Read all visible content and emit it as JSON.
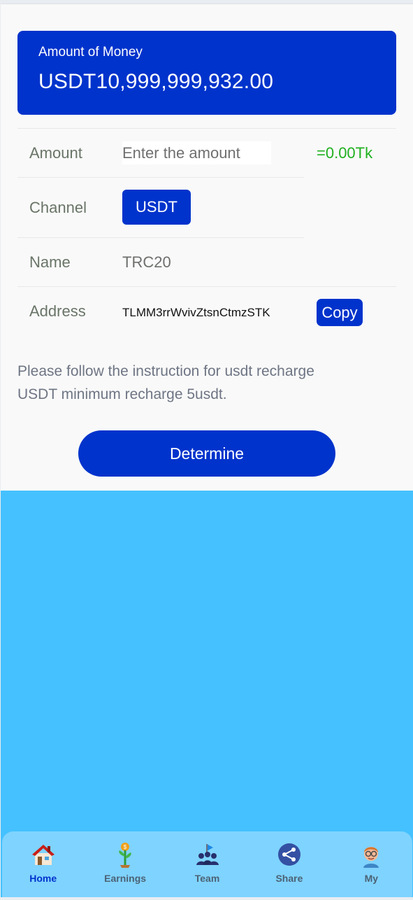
{
  "balance": {
    "title": "Amount of Money",
    "value": "USDT10,999,999,932.00"
  },
  "form": {
    "amount_label": "Amount",
    "amount_placeholder": "Enter the amount",
    "converted_value": "=0.00Tk",
    "channel_label": "Channel",
    "channel_button": "USDT",
    "name_label": "Name",
    "name_value": "TRC20",
    "address_label": "Address",
    "address_value": "TLMM3rrWvivZtsnCtmzSTK",
    "copy_button": "Copy"
  },
  "instructions": {
    "line1": "Please follow the instruction for usdt recharge",
    "line2": "USDT minimum recharge 5usdt."
  },
  "actions": {
    "determine_button": "Determine"
  },
  "nav": {
    "items": [
      {
        "label": "Home",
        "icon": "house-icon",
        "active": true
      },
      {
        "label": "Earnings",
        "icon": "money-plant-icon",
        "active": false
      },
      {
        "label": "Team",
        "icon": "team-icon",
        "active": false
      },
      {
        "label": "Share",
        "icon": "share-icon",
        "active": false
      },
      {
        "label": "My",
        "icon": "avatar-icon",
        "active": false
      }
    ]
  },
  "colors": {
    "primary": "#0033cc",
    "accent_green": "#20b020",
    "background_blue": "#45c1ff",
    "nav_background": "#7fd3ff"
  }
}
